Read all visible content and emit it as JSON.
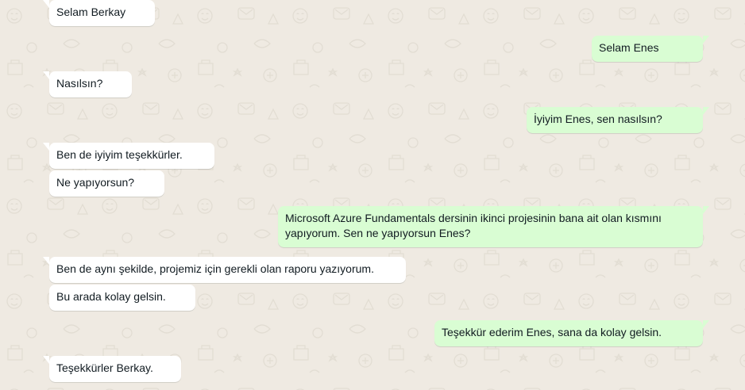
{
  "theme": {
    "chat_background": "#efeae2",
    "incoming_bubble": "#ffffff",
    "outgoing_bubble": "#d9fdd3",
    "text_color": "#111b21"
  },
  "messages": [
    {
      "direction": "in",
      "text": "Selam Berkay"
    },
    {
      "direction": "out",
      "text": "Selam Enes"
    },
    {
      "direction": "in",
      "text": "Nasılsın?"
    },
    {
      "direction": "out",
      "text": "İyiyim Enes, sen nasılsın?"
    },
    {
      "direction": "in",
      "text": "Ben de iyiyim teşekkürler."
    },
    {
      "direction": "in",
      "text": "Ne yapıyorsun?"
    },
    {
      "direction": "out",
      "text": "Microsoft Azure Fundamentals dersinin ikinci projesinin bana ait olan kısmını yapıyorum. Sen ne yapıyorsun Enes?"
    },
    {
      "direction": "in",
      "text": "Ben de aynı şekilde, projemiz için gerekli olan raporu yazıyorum."
    },
    {
      "direction": "in",
      "text": "Bu arada kolay gelsin."
    },
    {
      "direction": "out",
      "text": "Teşekkür ederim Enes, sana da kolay gelsin."
    },
    {
      "direction": "in",
      "text": "Teşekkürler Berkay."
    }
  ]
}
